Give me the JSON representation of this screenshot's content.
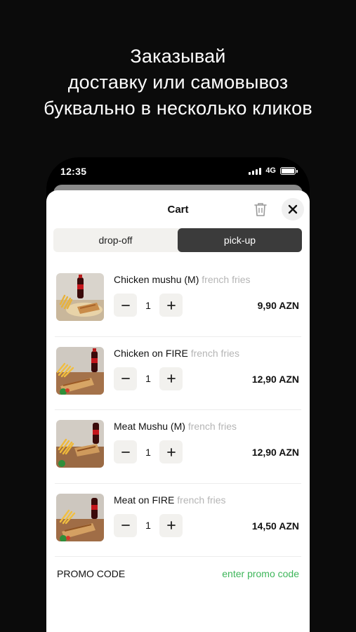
{
  "headline": {
    "line1": "Заказывай",
    "line2": "доставку или самовывоз",
    "line3": "буквально в несколько кликов"
  },
  "status_bar": {
    "time": "12:35",
    "network": "4G"
  },
  "cart": {
    "title": "Cart",
    "tabs": [
      {
        "label": "drop-off",
        "active": false
      },
      {
        "label": "pick-up",
        "active": true
      }
    ],
    "items": [
      {
        "name": "Chicken mushu (M)",
        "side": "french fries",
        "quantity": "1",
        "price": "9,90 AZN"
      },
      {
        "name": "Chicken on FIRE",
        "side": "french fries",
        "quantity": "1",
        "price": "12,90 AZN"
      },
      {
        "name": "Meat Mushu (M)",
        "side": "french fries",
        "quantity": "1",
        "price": "12,90 AZN"
      },
      {
        "name": "Meat on FIRE",
        "side": "french fries",
        "quantity": "1",
        "price": "14,50 AZN"
      }
    ],
    "promo": {
      "label": "PROMO CODE",
      "link": "enter promo code"
    }
  },
  "colors": {
    "background": "#0b0b0b",
    "active_tab": "#3b3b3b",
    "promo_link": "#3eb65a",
    "side_text": "#b5b5b5"
  }
}
